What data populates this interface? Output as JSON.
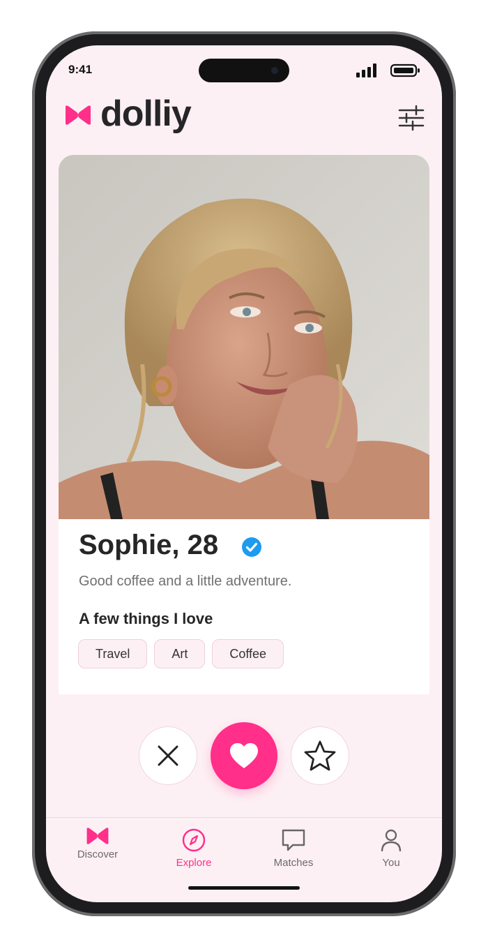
{
  "status_bar": {
    "time": "9:41"
  },
  "brand": {
    "name": "dolliy",
    "accent": "#ff2f8a"
  },
  "header": {
    "filter_icon": "sliders-icon"
  },
  "profile": {
    "name_age": "Sophie, 28",
    "verified": true,
    "bio": "Good coffee and a little adventure.",
    "interests_heading": "A few things I love",
    "interests": [
      "Travel",
      "Art",
      "Coffee"
    ]
  },
  "actions": {
    "pass_icon": "x-icon",
    "like_icon": "heart-icon",
    "superlike_icon": "star-icon"
  },
  "tabs": [
    {
      "label": "Discover",
      "icon": "bowtie-icon"
    },
    {
      "label": "Explore",
      "icon": "compass-icon",
      "active": true
    },
    {
      "label": "Matches",
      "icon": "chat-bubble-icon"
    },
    {
      "label": "You",
      "icon": "person-icon"
    }
  ]
}
